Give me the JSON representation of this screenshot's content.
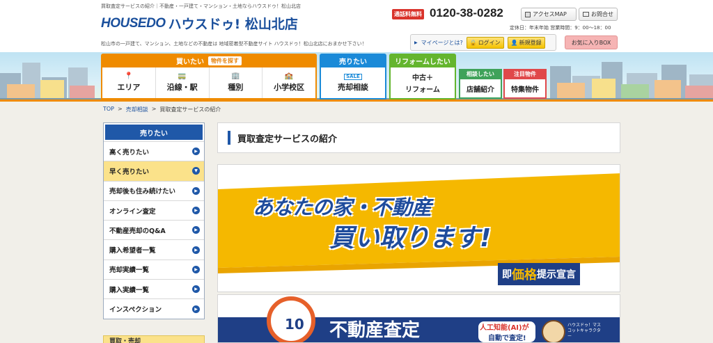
{
  "header": {
    "tagline": "買取査定サービスの紹介｜不動産・一戸建て・マンション・土地ならハウスドゥ！松山北店",
    "logo_mark": "HOUSEDO",
    "logo_name": "ハウスドゥ! 松山北店",
    "site_description": "松山市の一戸建て、マンション、土地などの不動産は 地域密着型不動産サイト ハウスドゥ！松山北店におまかせ下さい！",
    "phone_badge": "通話料無料",
    "phone_number": "0120-38-0282",
    "access_map": "アクセスMAP",
    "contact": "お問合せ",
    "hours": "定休日：年末年始  営業時間：9：00～18：00",
    "mypage_link": "マイページとは?",
    "login": "ログイン",
    "register": "新規登録",
    "favorites": "お気に入りBOX"
  },
  "nav": {
    "buy": {
      "label": "買いたい",
      "search_tag": "物件を探す",
      "items": [
        "エリア",
        "沿線・駅",
        "種別",
        "小学校区"
      ]
    },
    "sell": {
      "label": "売りたい",
      "sale_tag": "SALE",
      "item": "売却相談"
    },
    "reform": {
      "label": "リフォームしたい",
      "item_line1": "中古＋",
      "item_line2": "リフォーム"
    },
    "consult": {
      "label": "相談したい",
      "item": "店舗紹介"
    },
    "featured": {
      "label": "注目物件",
      "item": "特集物件"
    }
  },
  "breadcrumb": {
    "top": "TOP",
    "sell": "売却相談",
    "current": "買取査定サービスの紹介",
    "sep": ">"
  },
  "sidebar": {
    "heading": "売りたい",
    "items": [
      {
        "label": "高く売りたい"
      },
      {
        "label": "早く売りたい"
      },
      {
        "label": "売却後も住み続けたい"
      },
      {
        "label": "オンライン査定"
      },
      {
        "label": "不動産売却のQ&A"
      },
      {
        "label": "購入希望者一覧"
      },
      {
        "label": "売却実績一覧"
      },
      {
        "label": "購入実績一覧"
      },
      {
        "label": "インスペクション"
      }
    ],
    "next_section": "買取・売却"
  },
  "main": {
    "page_title": "買取査定サービスの紹介",
    "banner": {
      "line1": "あなたの家・不動産",
      "line2": "買い取ります!",
      "tag_pre": "即",
      "tag_highlight": "価格",
      "tag_post": "提示宣言"
    },
    "banner2": {
      "clock_num": "10",
      "title": "不動産査定",
      "ai_line1": "人工知能(AI)が",
      "ai_line2": "自動で査定!",
      "mascot": "ハウスドゥ！マスコットキャラクター"
    }
  },
  "colors": {
    "brand_blue": "#1f58a8",
    "buy_orange": "#ef8b00",
    "sell_blue": "#1a8ad8",
    "reform_green": "#64b52e",
    "consult_green": "#3fa25a",
    "featured_red": "#e0484a",
    "banner_yellow": "#f5b800",
    "active_item": "#fbe28a"
  }
}
